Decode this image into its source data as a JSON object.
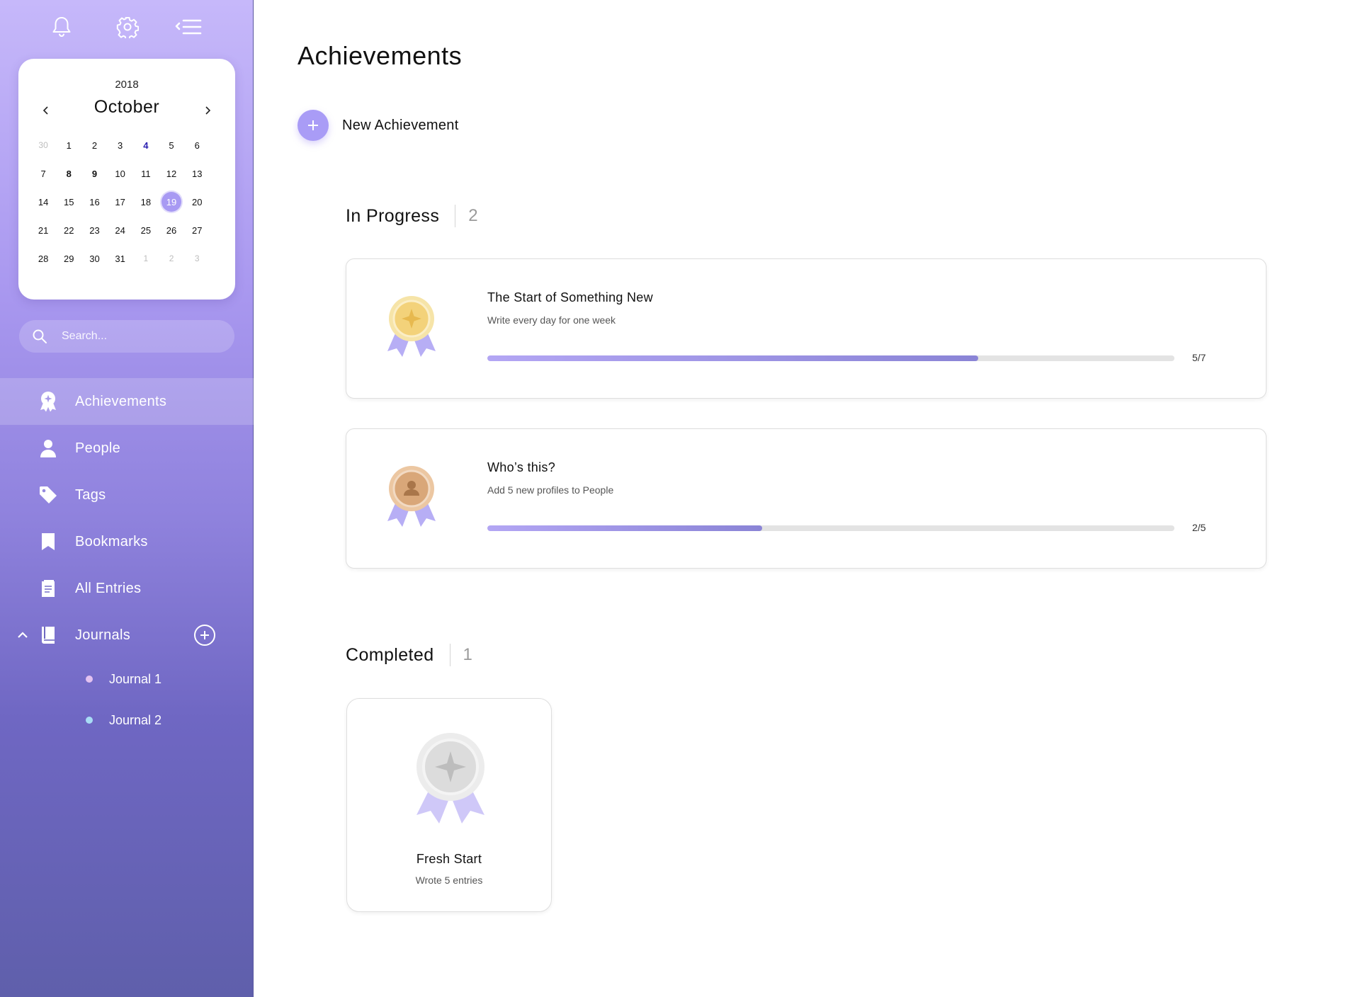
{
  "sidebar": {
    "calendar": {
      "year": "2018",
      "month": "October",
      "days": [
        {
          "d": "30",
          "s": "muted"
        },
        {
          "d": "1",
          "s": ""
        },
        {
          "d": "2",
          "s": ""
        },
        {
          "d": "3",
          "s": ""
        },
        {
          "d": "4",
          "s": "today"
        },
        {
          "d": "5",
          "s": ""
        },
        {
          "d": "6",
          "s": ""
        },
        {
          "d": "7",
          "s": ""
        },
        {
          "d": "8",
          "s": "bold"
        },
        {
          "d": "9",
          "s": "bold"
        },
        {
          "d": "10",
          "s": ""
        },
        {
          "d": "11",
          "s": ""
        },
        {
          "d": "12",
          "s": ""
        },
        {
          "d": "13",
          "s": ""
        },
        {
          "d": "14",
          "s": ""
        },
        {
          "d": "15",
          "s": ""
        },
        {
          "d": "16",
          "s": ""
        },
        {
          "d": "17",
          "s": ""
        },
        {
          "d": "18",
          "s": ""
        },
        {
          "d": "19",
          "s": "selected"
        },
        {
          "d": "20",
          "s": ""
        },
        {
          "d": "21",
          "s": ""
        },
        {
          "d": "22",
          "s": ""
        },
        {
          "d": "23",
          "s": ""
        },
        {
          "d": "24",
          "s": ""
        },
        {
          "d": "25",
          "s": ""
        },
        {
          "d": "26",
          "s": ""
        },
        {
          "d": "27",
          "s": ""
        },
        {
          "d": "28",
          "s": ""
        },
        {
          "d": "29",
          "s": ""
        },
        {
          "d": "30",
          "s": ""
        },
        {
          "d": "31",
          "s": ""
        },
        {
          "d": "1",
          "s": "muted"
        },
        {
          "d": "2",
          "s": "muted"
        },
        {
          "d": "3",
          "s": "muted"
        }
      ]
    },
    "search": {
      "placeholder": "Search..."
    },
    "nav": [
      {
        "label": "Achievements",
        "icon": "achievement-icon",
        "active": true
      },
      {
        "label": "People",
        "icon": "person-icon",
        "active": false
      },
      {
        "label": "Tags",
        "icon": "tag-icon",
        "active": false
      },
      {
        "label": "Bookmarks",
        "icon": "bookmark-icon",
        "active": false
      },
      {
        "label": "All Entries",
        "icon": "entries-icon",
        "active": false
      },
      {
        "label": "Journals",
        "icon": "journal-icon",
        "active": false
      }
    ],
    "journals": [
      {
        "label": "Journal 1",
        "color": "#e3c2f0"
      },
      {
        "label": "Journal 2",
        "color": "#a8dcf5"
      }
    ]
  },
  "main": {
    "title": "Achievements",
    "new_achievement_label": "New Achievement",
    "in_progress": {
      "title": "In Progress",
      "count": "2",
      "items": [
        {
          "title": "The Start of Something New",
          "desc": "Write every day for one week",
          "progress": "5/7",
          "fraction": 0.714,
          "medal": "gold-star-medal-icon"
        },
        {
          "title": "Who’s this?",
          "desc": "Add 5 new profiles to People",
          "progress": "2/5",
          "fraction": 0.4,
          "medal": "bronze-person-medal-icon"
        }
      ]
    },
    "completed": {
      "title": "Completed",
      "count": "1",
      "items": [
        {
          "title": "Fresh Start",
          "desc": "Wrote 5 entries",
          "medal": "silver-star-medal-icon"
        }
      ]
    }
  },
  "colors": {
    "accent": "#a99cf6",
    "sidebar_top": "#c6b8fa",
    "sidebar_bottom": "#5f5fab",
    "gold": "#f3d27a",
    "bronze": "#d9a779",
    "silver": "#dcdcdc",
    "ribbon": "#b7aef5"
  }
}
